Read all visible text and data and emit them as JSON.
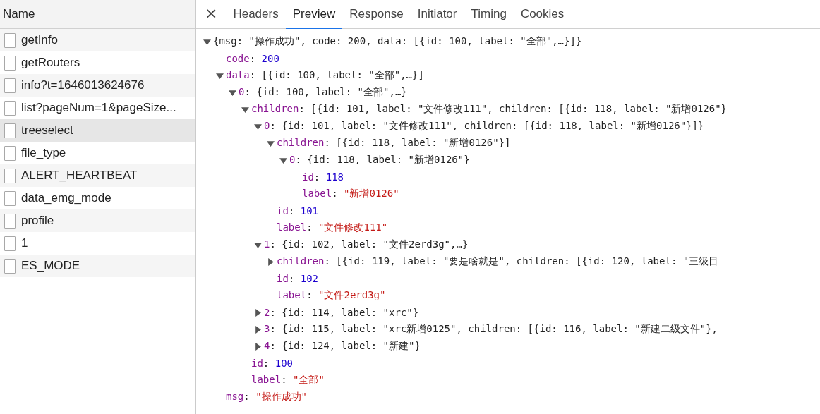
{
  "requests": {
    "header": "Name",
    "items": [
      {
        "name": "getInfo",
        "selected": false
      },
      {
        "name": "getRouters",
        "selected": false
      },
      {
        "name": "info?t=1646013624676",
        "selected": false
      },
      {
        "name": "list?pageNum=1&pageSize...",
        "selected": false
      },
      {
        "name": "treeselect",
        "selected": true
      },
      {
        "name": "file_type",
        "selected": false
      },
      {
        "name": "ALERT_HEARTBEAT",
        "selected": false
      },
      {
        "name": "data_emg_mode",
        "selected": false
      },
      {
        "name": "profile",
        "selected": false
      },
      {
        "name": "1",
        "selected": false
      },
      {
        "name": "ES_MODE",
        "selected": false
      }
    ]
  },
  "details": {
    "close": "×",
    "tabs": [
      {
        "label": "Headers",
        "selected": false
      },
      {
        "label": "Preview",
        "selected": true
      },
      {
        "label": "Response",
        "selected": false
      },
      {
        "label": "Initiator",
        "selected": false
      },
      {
        "label": "Timing",
        "selected": false
      },
      {
        "label": "Cookies",
        "selected": false
      }
    ],
    "preview": {
      "value": "{msg: \"操作成功\", code: 200, data: [{id: 100, label: \"全部\",…}]}",
      "kind": "object",
      "expanded": true,
      "children": [
        {
          "key": "code:",
          "value": "200",
          "kind": "number"
        },
        {
          "key": "data:",
          "value": "[{id: 100, label: \"全部\",…}]",
          "kind": "object",
          "expanded": true,
          "children": [
            {
              "key": "0:",
              "value": "{id: 100, label: \"全部\",…}",
              "kind": "object",
              "expanded": true,
              "children": [
                {
                  "key": "children:",
                  "value": "[{id: 101, label: \"文件修改111\", children: [{id: 118, label: \"新增0126\"}",
                  "kind": "object",
                  "expanded": true,
                  "children": [
                    {
                      "key": "0:",
                      "value": "{id: 101, label: \"文件修改111\", children: [{id: 118, label: \"新增0126\"}]}",
                      "kind": "object",
                      "expanded": true,
                      "children": [
                        {
                          "key": "children:",
                          "value": "[{id: 118, label: \"新增0126\"}]",
                          "kind": "object",
                          "expanded": true,
                          "children": [
                            {
                              "key": "0:",
                              "value": "{id: 118, label: \"新增0126\"}",
                              "kind": "object",
                              "expanded": true,
                              "children": [
                                {
                                  "key": "id:",
                                  "value": "118",
                                  "kind": "number"
                                },
                                {
                                  "key": "label:",
                                  "value": "\"新增0126\"",
                                  "kind": "string"
                                }
                              ]
                            }
                          ]
                        },
                        {
                          "key": "id:",
                          "value": "101",
                          "kind": "number"
                        },
                        {
                          "key": "label:",
                          "value": "\"文件修改111\"",
                          "kind": "string"
                        }
                      ]
                    },
                    {
                      "key": "1:",
                      "value": "{id: 102, label: \"文件2erd3g\",…}",
                      "kind": "object",
                      "expanded": true,
                      "children": [
                        {
                          "key": "children:",
                          "value": "[{id: 119, label: \"要是啥就是\", children: [{id: 120, label: \"三级目",
                          "kind": "object",
                          "expanded": false
                        },
                        {
                          "key": "id:",
                          "value": "102",
                          "kind": "number"
                        },
                        {
                          "key": "label:",
                          "value": "\"文件2erd3g\"",
                          "kind": "string"
                        }
                      ]
                    },
                    {
                      "key": "2:",
                      "value": "{id: 114, label: \"xrc\"}",
                      "kind": "object",
                      "expanded": false
                    },
                    {
                      "key": "3:",
                      "value": "{id: 115, label: \"xrc新增0125\", children: [{id: 116, label: \"新建二级文件\"},",
                      "kind": "object",
                      "expanded": false
                    },
                    {
                      "key": "4:",
                      "value": "{id: 124, label: \"新建\"}",
                      "kind": "object",
                      "expanded": false
                    }
                  ]
                },
                {
                  "key": "id:",
                  "value": "100",
                  "kind": "number"
                },
                {
                  "key": "label:",
                  "value": "\"全部\"",
                  "kind": "string"
                }
              ]
            }
          ]
        },
        {
          "key": "msg:",
          "value": "\"操作成功\"",
          "kind": "string"
        }
      ]
    }
  }
}
